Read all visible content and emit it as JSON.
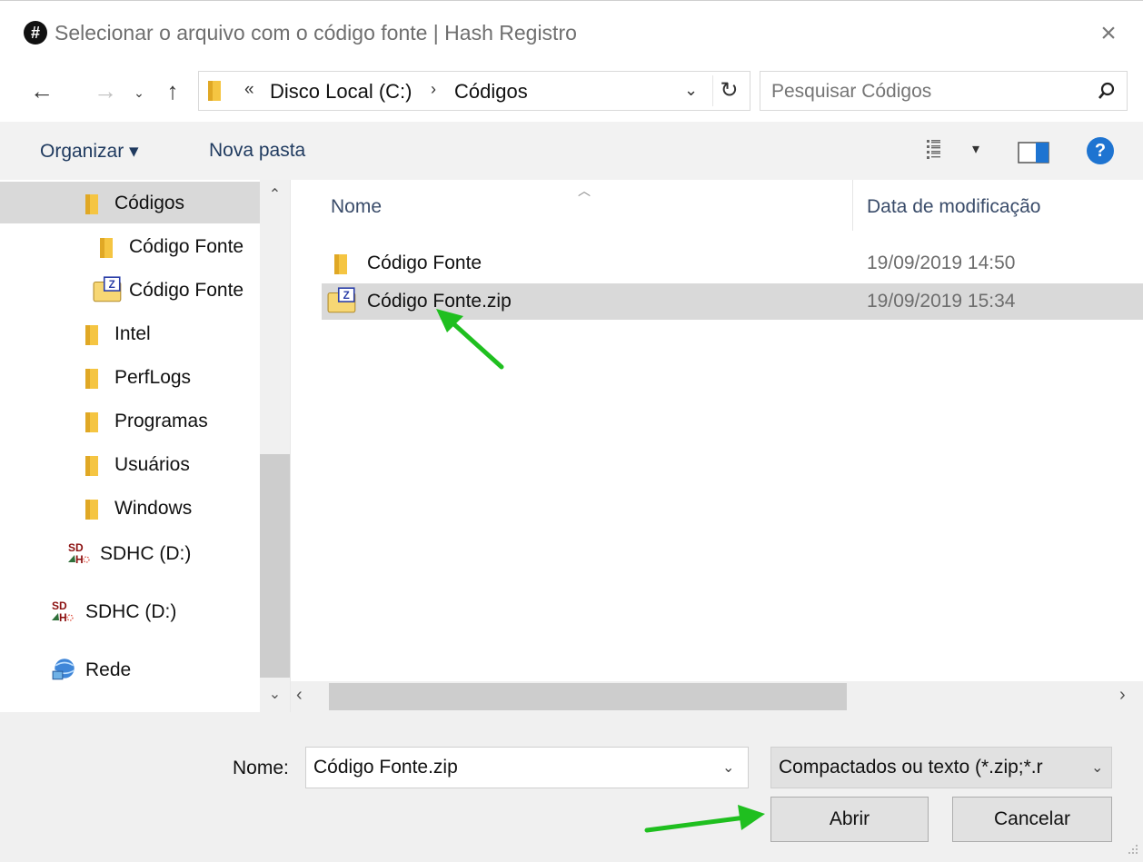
{
  "window": {
    "title": "Selecionar o arquivo com o código fonte | Hash Registro",
    "app_icon_glyph": "#",
    "close_glyph": "×"
  },
  "navbar": {
    "back_glyph": "←",
    "forward_glyph": "→",
    "recent_glyph": "⌄",
    "up_glyph": "↑",
    "breadcrumb_overflow": "«",
    "breadcrumbs": [
      "Disco Local (C:)",
      "Códigos"
    ],
    "breadcrumb_separator": "›",
    "dropdown_glyph": "⌄",
    "refresh_glyph": "↻",
    "search_placeholder": "Pesquisar Códigos"
  },
  "toolbar": {
    "organize_label": "Organizar ▾",
    "new_folder_label": "Nova pasta",
    "view_dropdown_glyph": "▾",
    "help_glyph": "?"
  },
  "nav_pane": {
    "items": [
      {
        "label": "Códigos",
        "icon": "folder-icon",
        "selected": true
      },
      {
        "label": "Código Fonte",
        "icon": "folder-icon"
      },
      {
        "label": "Código Fonte",
        "icon": "zip-folder-icon"
      },
      {
        "label": "Intel",
        "icon": "folder-icon"
      },
      {
        "label": "PerfLogs",
        "icon": "folder-icon"
      },
      {
        "label": "Programas",
        "icon": "folder-icon"
      },
      {
        "label": "Usuários",
        "icon": "folder-icon"
      },
      {
        "label": "Windows",
        "icon": "folder-icon"
      },
      {
        "label": "SDHC (D:)",
        "icon": "sd-card-icon"
      },
      {
        "label": "SDHC (D:)",
        "icon": "sd-card-icon"
      },
      {
        "label": "Rede",
        "icon": "network-icon"
      }
    ],
    "scroll_up_glyph": "⌃",
    "scroll_down_glyph": "⌄"
  },
  "file_list": {
    "columns": {
      "name": "Nome",
      "date": "Data de modificação"
    },
    "sort_glyph": "︿",
    "rows": [
      {
        "name": "Código Fonte",
        "date": "19/09/2019 14:50",
        "icon": "folder-icon"
      },
      {
        "name": "Código Fonte.zip",
        "date": "19/09/2019 15:34",
        "icon": "zip-folder-icon",
        "selected": true
      }
    ],
    "hscroll_left_glyph": "‹",
    "hscroll_right_glyph": "›"
  },
  "bottom": {
    "name_label": "Nome:",
    "name_value": "Código Fonte.zip",
    "name_dropdown_glyph": "⌄",
    "filetype_value": "Compactados ou texto (*.zip;*.r",
    "filetype_dropdown_glyph": "⌄",
    "open_label": "Abrir",
    "cancel_label": "Cancelar"
  },
  "colors": {
    "selection": "#d9d9d9",
    "folder": "#f5c542",
    "accent": "#1e74d1",
    "annotation_arrow": "#1fbf1f"
  }
}
